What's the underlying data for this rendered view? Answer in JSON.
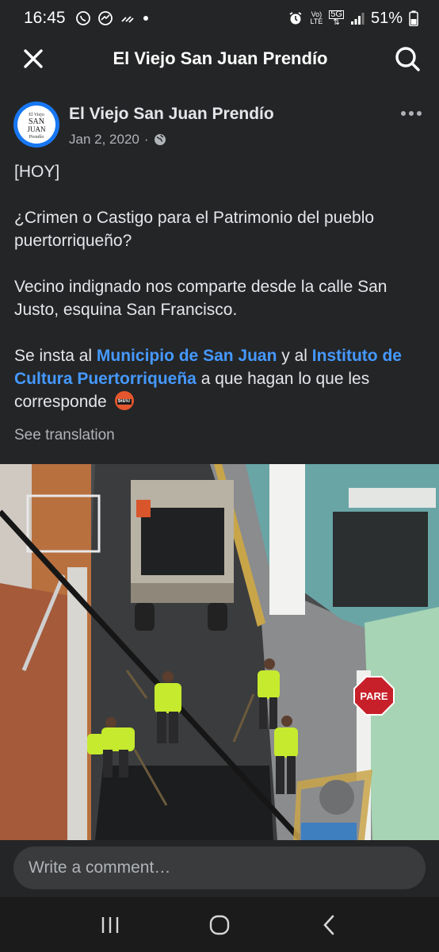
{
  "status_bar": {
    "time": "16:45",
    "battery": "51%",
    "network_5g": "5G",
    "volte_top": "Vo)",
    "volte_bottom": "LTE",
    "icons": [
      "whatsapp-icon",
      "messenger-icon",
      "signal-activity-icon",
      "notification-dot",
      "alarm-icon",
      "volte-icon",
      "5g-icon",
      "signal-icon",
      "battery-icon"
    ]
  },
  "topbar": {
    "title": "El Viejo San Juan Prendío",
    "close_icon": "close-icon",
    "search_icon": "search-icon"
  },
  "post": {
    "page_name": "El Viejo San Juan Prendío",
    "date": "Jan 2, 2020",
    "separator": "·",
    "audience_icon": "globe-icon",
    "avatar_text_1": "El Viejo",
    "avatar_text_2": "SAN",
    "avatar_text_3": "JUAN",
    "avatar_text_4": "Prendío",
    "paragraph_1": "[HOY]",
    "paragraph_2": "¿Crimen o Castigo para el Patrimonio del pueblo puertorriqueño?",
    "paragraph_3": "Vecino indignado nos comparte desde la calle San Justo, esquina San Francisco.",
    "p4_text_1": "Se insta al ",
    "p4_link_1": "Municipio de San Juan",
    "p4_text_2": " y al ",
    "p4_link_2": "Instituto de Cultura Puertorriqueña",
    "p4_text_3": " a que hagan lo que les corresponde ",
    "emoji_text": "$#&%!",
    "see_translation": "See translation"
  },
  "photo": {
    "sign_text": "PARE"
  },
  "comment": {
    "placeholder": "Write a comment…"
  },
  "navbar": {
    "recents_icon": "recents-icon",
    "home_icon": "home-icon",
    "back_icon": "back-icon"
  }
}
